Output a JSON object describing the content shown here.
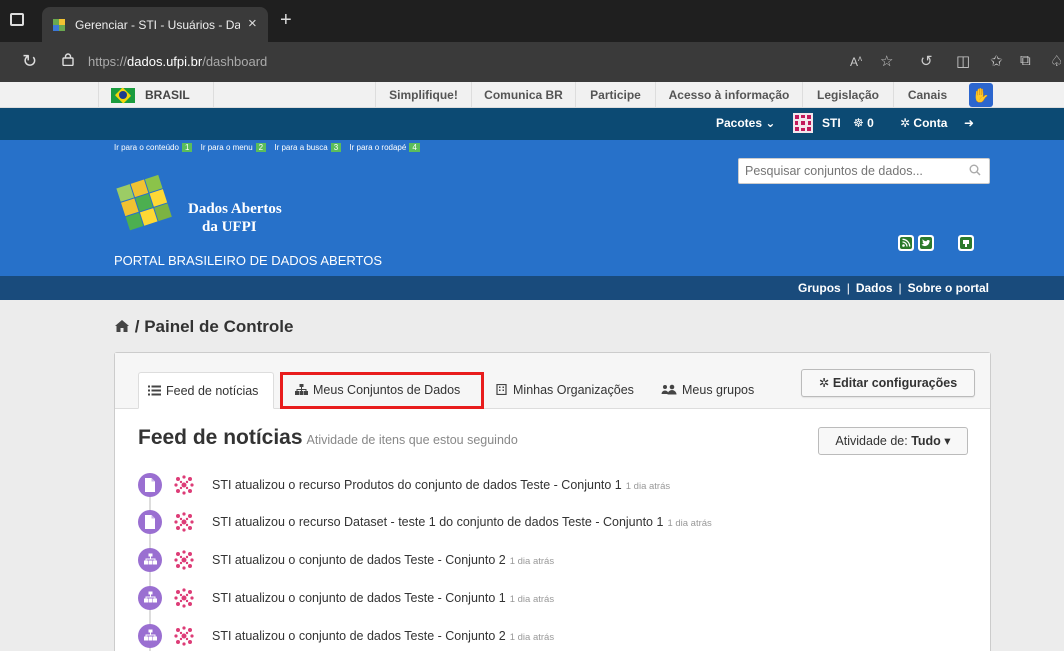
{
  "browser": {
    "tab_title": "Gerenciar - STI - Usuários - Dados",
    "tab_close": "×",
    "new_tab": "+",
    "url_prefix": "https://",
    "url_host": "dados.ufpi.br",
    "url_path": "/dashboard"
  },
  "govbar": {
    "brasil_label": "BRASIL",
    "links": [
      "Simplifique!",
      "Comunica BR",
      "Participe",
      "Acesso à informação",
      "Legislação",
      "Canais"
    ]
  },
  "account": {
    "pacotes": "Pacotes",
    "user": "STI",
    "followers": "0",
    "conta": "Conta"
  },
  "header": {
    "skiplinks": [
      {
        "label": "Ir para o conteúdo",
        "key": "1"
      },
      {
        "label": "Ir para o menu",
        "key": "2"
      },
      {
        "label": "Ir para a busca",
        "key": "3"
      },
      {
        "label": "Ir para o rodapé",
        "key": "4"
      }
    ],
    "logo_line1": "Dados Abertos",
    "logo_line2": "da UFPI",
    "portal_title": "PORTAL BRASILEIRO DE DADOS ABERTOS",
    "search_placeholder": "Pesquisar conjuntos de dados..."
  },
  "nav": {
    "links": [
      "Grupos",
      "Dados",
      "Sobre o portal"
    ],
    "separator": "|"
  },
  "page": {
    "breadcrumb_sep": "/",
    "title": "Painel de Controle",
    "tabs": [
      {
        "label": "Feed de notícias",
        "icon": "list-icon",
        "active": true
      },
      {
        "label": "Meus Conjuntos de Dados",
        "icon": "sitemap-icon",
        "active": false
      },
      {
        "label": "Minhas Organizações",
        "icon": "building-icon",
        "active": false
      },
      {
        "label": "Meus grupos",
        "icon": "group-icon",
        "active": false
      }
    ],
    "edit_button": "Editar configurações",
    "feed_heading": "Feed de notícias",
    "feed_subheading": "Atividade de itens que estou seguindo",
    "activity_label": "Atividade de:",
    "activity_value": "Tudo",
    "feed_items": [
      {
        "icon": "file-icon",
        "text": "STI atualizou o recurso Produtos do conjunto de dados Teste - Conjunto 1",
        "time": "1 dia atrás"
      },
      {
        "icon": "file-icon",
        "text": "STI atualizou o recurso Dataset - teste 1 do conjunto de dados Teste - Conjunto 1",
        "time": "1 dia atrás"
      },
      {
        "icon": "sitemap-icon",
        "text": "STI atualizou o conjunto de dados Teste - Conjunto 2",
        "time": "1 dia atrás"
      },
      {
        "icon": "sitemap-icon",
        "text": "STI atualizou o conjunto de dados Teste - Conjunto 1",
        "time": "1 dia atrás"
      },
      {
        "icon": "sitemap-icon",
        "text": "STI atualizou o conjunto de dados Teste - Conjunto 2",
        "time": "1 dia atrás"
      }
    ]
  },
  "colors": {
    "header_blue": "#2771c9",
    "account_bar": "#0c4a73",
    "nav_bar": "#194b7c",
    "feed_bubble": "#9a6fd1",
    "highlight_red": "#e81c1c"
  }
}
